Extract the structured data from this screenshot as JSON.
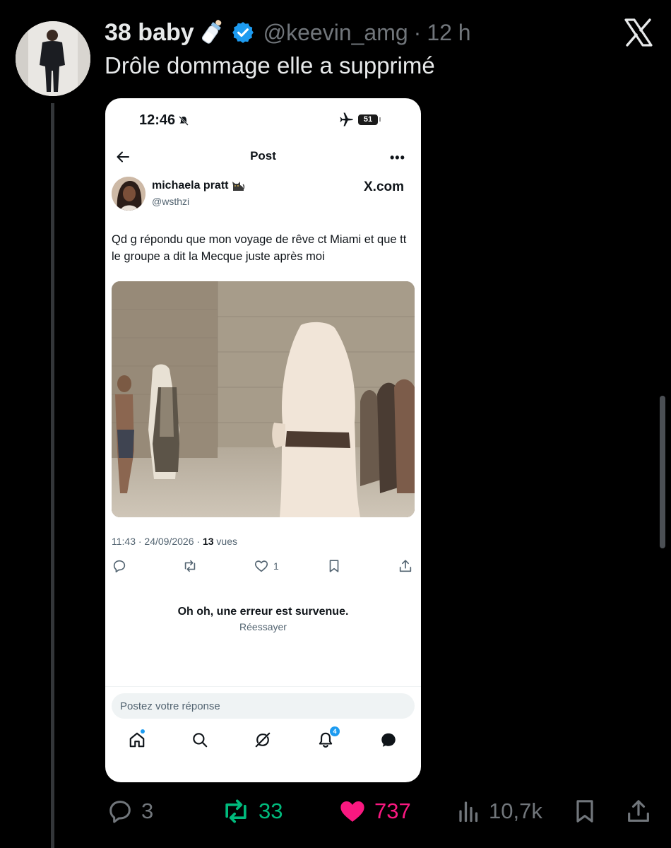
{
  "author": {
    "display_name": "38 baby",
    "handle": "@keevin_amg",
    "separator": "·",
    "time": "12 h"
  },
  "tweet": {
    "text": "Drôle dommage elle a supprimé"
  },
  "screenshot": {
    "status_time": "12:46",
    "battery": "51",
    "nav_title": "Post",
    "more": "•••",
    "post": {
      "name": "michaela pratt",
      "handle": "@wsthzi",
      "brand": "X.com",
      "text": "Qd g répondu que mon voyage de rêve ct Miami et que tt le groupe a dit la Mecque juste après moi",
      "timestamp": "11:43 · 24/09/2026 · ",
      "views_count": "13",
      "views_label": " vues",
      "likes": "1"
    },
    "error": {
      "title": "Oh oh, une erreur est survenue.",
      "retry": "Réessayer"
    },
    "reply_placeholder": "Postez votre réponse",
    "notifications_badge": "4"
  },
  "actions": {
    "replies": "3",
    "reposts": "33",
    "likes": "737",
    "views": "10,7k"
  },
  "colors": {
    "background": "#000000",
    "text": "#e7e9ea",
    "muted": "#71767b",
    "verified": "#1d9bf0",
    "repost": "#00ba7c",
    "like": "#f91880"
  },
  "icons": [
    "baby-bottle-icon",
    "verified-badge-icon",
    "x-logo-icon",
    "reply-icon",
    "repost-icon",
    "heart-icon",
    "views-icon",
    "bookmark-icon",
    "share-icon",
    "home-icon",
    "search-icon",
    "grok-icon",
    "bell-icon",
    "messages-icon",
    "back-arrow-icon",
    "airplane-icon",
    "mute-bell-icon"
  ]
}
